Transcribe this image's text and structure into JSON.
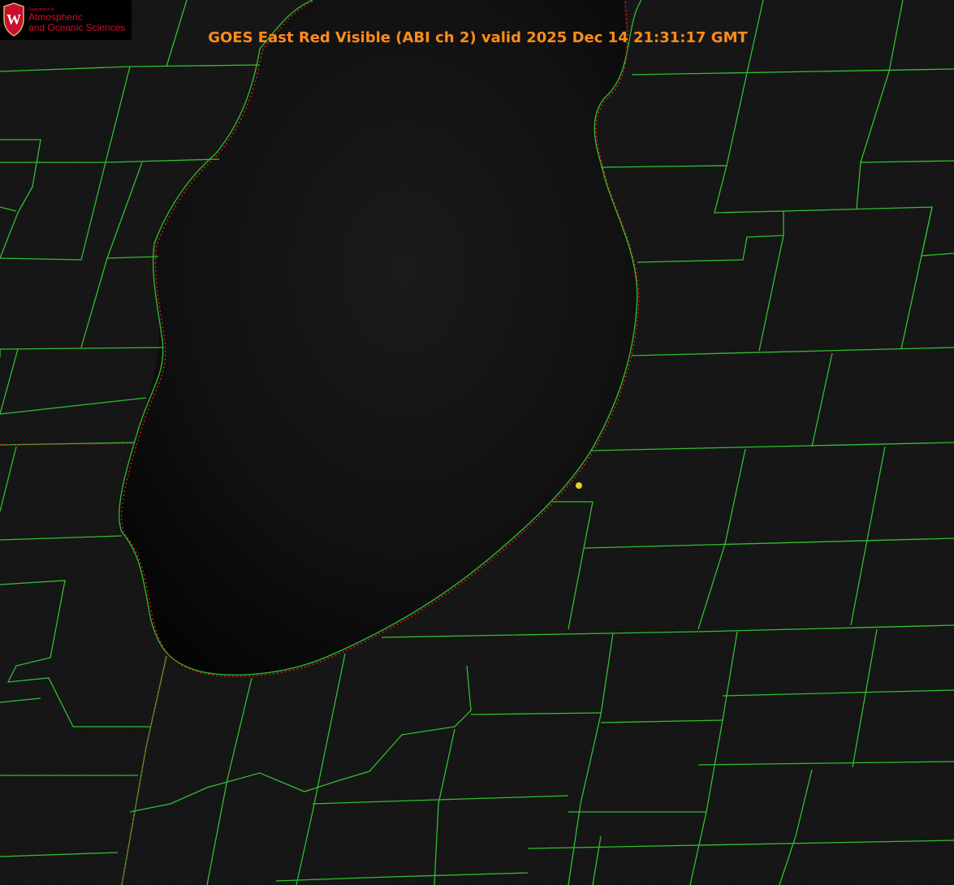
{
  "title": "GOES East Red Visible (ABI ch 2) valid 2025 Dec 14 21:31:17 GMT",
  "logo": {
    "dept": "Department of",
    "line1": "Atmospheric",
    "line2": "and Oceanic Sciences",
    "seal_letter": "W"
  },
  "colors": {
    "background": "#151515",
    "lake": "#0a0a0a",
    "county_lines": "#2fbf2f",
    "state_line": "#d81e1e",
    "title": "#ff8c1a",
    "station_marker": "#e6d21e",
    "logo_text": "#c8102e"
  },
  "map": {
    "layers": [
      "county-boundaries",
      "state-boundaries",
      "shoreline",
      "station-marker"
    ],
    "marker_count": 1
  }
}
